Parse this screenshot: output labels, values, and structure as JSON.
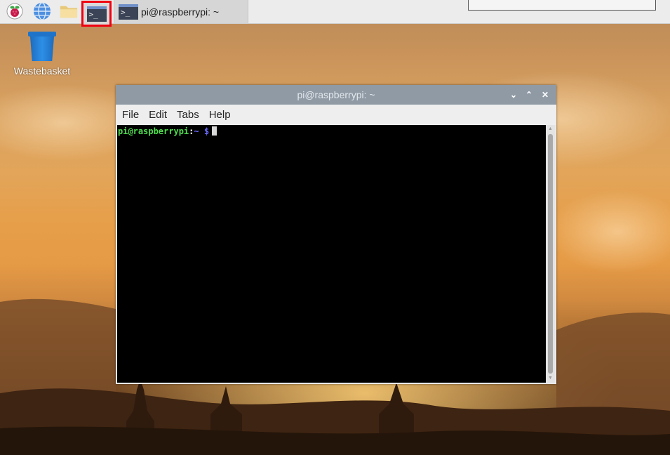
{
  "taskbar": {
    "launchers": [
      {
        "icon": "raspberry-pi-menu-icon"
      },
      {
        "icon": "web-browser-icon"
      },
      {
        "icon": "file-manager-folder-icon"
      },
      {
        "icon": "terminal-launcher-icon",
        "glyph": ">_"
      }
    ],
    "task_button": {
      "icon": "terminal-icon",
      "glyph": ">_",
      "label": "pi@raspberrypi: ~"
    }
  },
  "desktop": {
    "icons": [
      {
        "icon": "wastebasket-icon",
        "label": "Wastebasket"
      }
    ]
  },
  "terminal_window": {
    "title": "pi@raspberrypi: ~",
    "controls": {
      "minimize": "⌄",
      "maximize": "⌃",
      "close": "✕"
    },
    "menu": [
      "File",
      "Edit",
      "Tabs",
      "Help"
    ],
    "prompt": {
      "user_host": "pi@raspberrypi",
      "separator": ":",
      "path": "~",
      "symbol": "$"
    }
  },
  "colors": {
    "highlight_box": "#f00010",
    "prompt_user": "#4ee04e",
    "prompt_path": "#6b6bff",
    "titlebar": "#8f9aa5"
  }
}
